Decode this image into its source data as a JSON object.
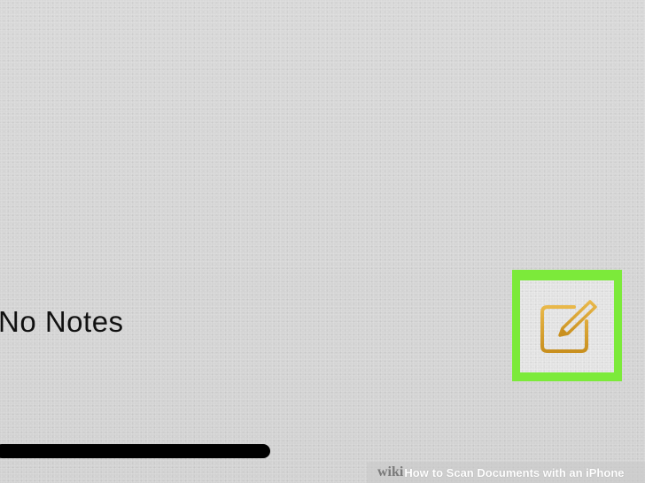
{
  "notes": {
    "empty_state_text": "No Notes",
    "compose_icon": "compose-note-icon"
  },
  "colors": {
    "highlight": "#7cea3a",
    "icon_gold": "#d9a532",
    "background": "#d4d4d4"
  },
  "watermark": {
    "brand": "wiki",
    "how": "How",
    "title": "to Scan Documents with an iPhone"
  }
}
